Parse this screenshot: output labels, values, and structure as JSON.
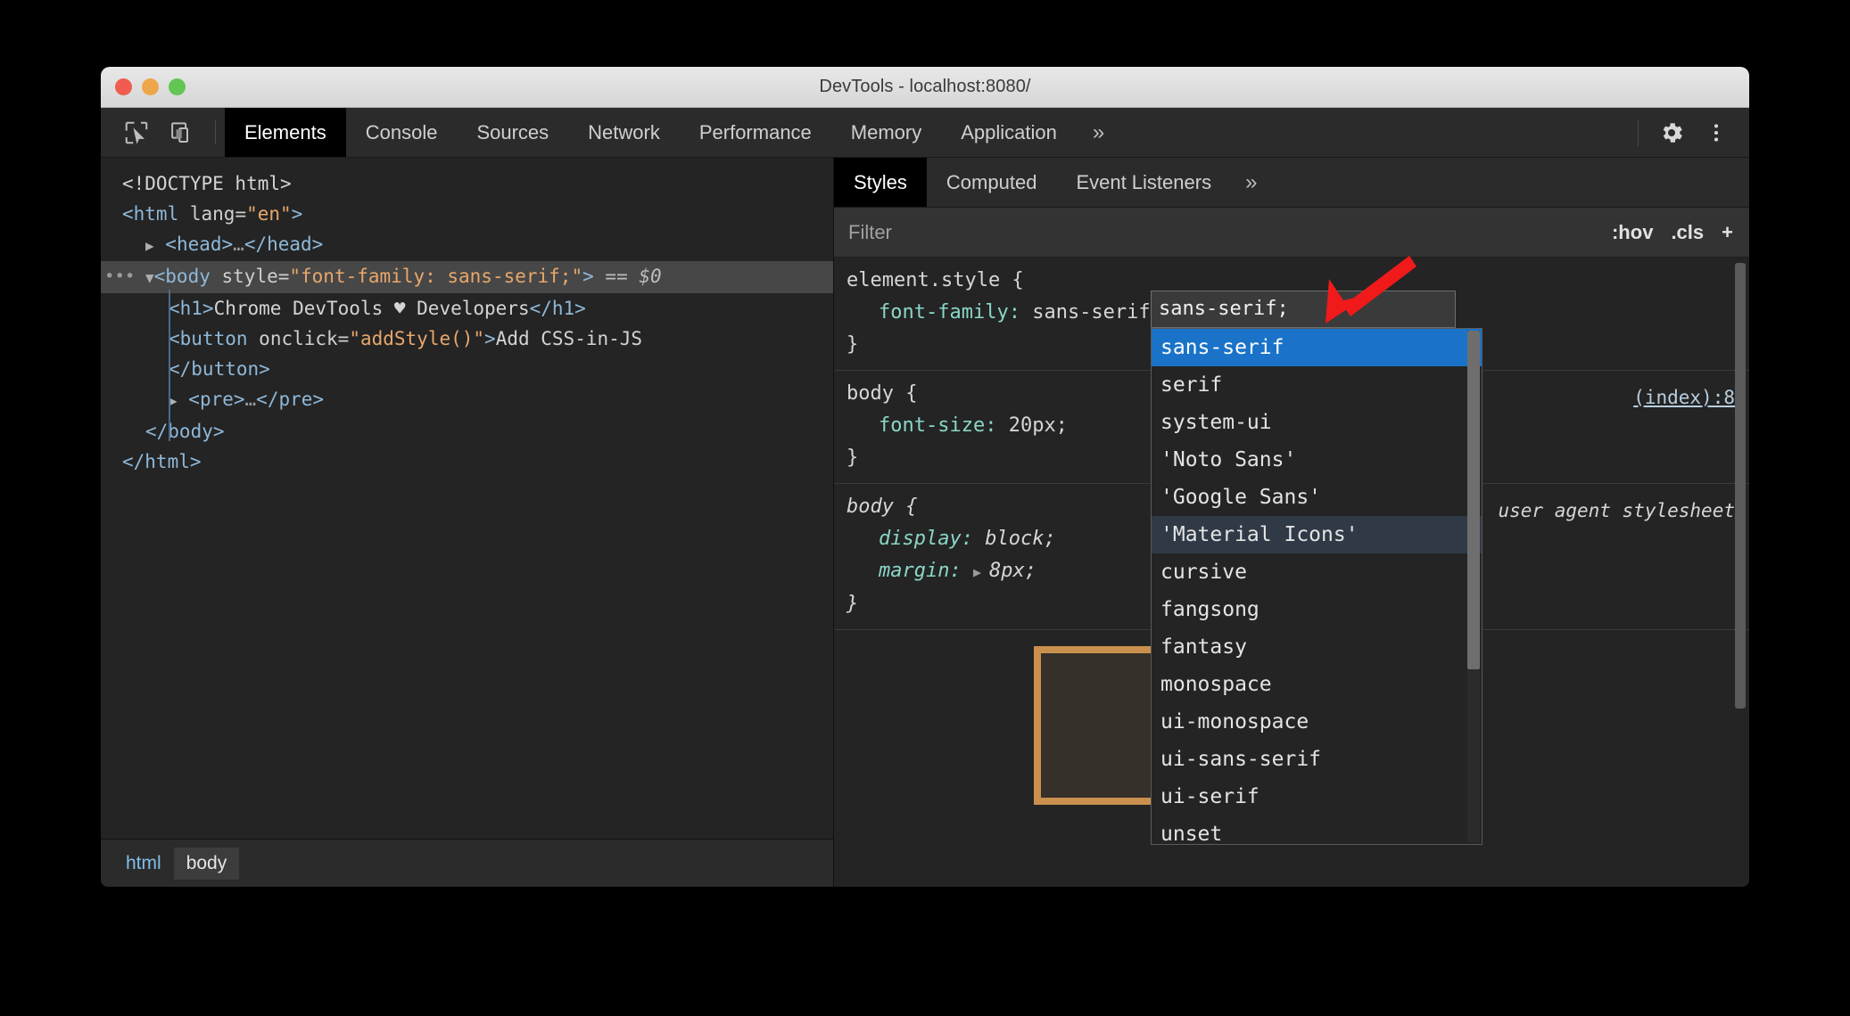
{
  "window": {
    "title": "DevTools - localhost:8080/",
    "traffic_lights": [
      "close-button",
      "minimize-button",
      "zoom-button"
    ]
  },
  "toolbar": {
    "inspect_icon": "inspect-element-icon",
    "device_icon": "device-toolbar-icon",
    "tabs": [
      {
        "label": "Elements",
        "active": true
      },
      {
        "label": "Console",
        "active": false
      },
      {
        "label": "Sources",
        "active": false
      },
      {
        "label": "Network",
        "active": false
      },
      {
        "label": "Performance",
        "active": false
      },
      {
        "label": "Memory",
        "active": false
      },
      {
        "label": "Application",
        "active": false
      }
    ],
    "more_tabs": "»",
    "settings_icon": "gear-icon",
    "menu_icon": "kebab-menu-icon"
  },
  "dom_tree": {
    "lines": [
      {
        "indent": 0,
        "html": "<span class=\"txt\">&lt;!DOCTYPE html&gt;</span>"
      },
      {
        "indent": 0,
        "html": "<span class=\"tw\">&lt;html</span> <span class=\"attr\">lang=</span><span class=\"attrval\">\"en\"</span><span class=\"tw\">&gt;</span>"
      },
      {
        "indent": 1,
        "html": "<span class=\"arrow-t\">▶</span> <span class=\"tw\">&lt;head&gt;</span><span class=\"dim\">…</span><span class=\"tw\">&lt;/head&gt;</span>"
      },
      {
        "indent": 1,
        "html": "<span class=\"arrow-t\">▼</span><span class=\"tw\">&lt;body</span> <span class=\"attr\">style=</span><span class=\"attrval\">\"font-family: sans-serif;\"</span><span class=\"tw\">&gt;</span> <span class=\"eqd\">== $0</span>",
        "selected": true
      },
      {
        "indent": 2,
        "html": "<span class=\"tw\">&lt;h1&gt;</span><span class=\"txt\">Chrome DevTools ♥ Developers</span><span class=\"tw\">&lt;/h1&gt;</span>"
      },
      {
        "indent": 2,
        "html": "<span class=\"tw\">&lt;button</span> <span class=\"attr\">onclick=</span><span class=\"attrval\">\"addStyle()\"</span><span class=\"tw\">&gt;</span><span class=\"txt\">Add CSS-in-JS</span>"
      },
      {
        "indent": 2,
        "html": "<span class=\"tw\">&lt;/button&gt;</span>"
      },
      {
        "indent": 2,
        "html": "<span class=\"arrow-t\">▶</span> <span class=\"tw\">&lt;pre&gt;</span><span class=\"dim\">…</span><span class=\"tw\">&lt;/pre&gt;</span>"
      },
      {
        "indent": 1,
        "html": "<span class=\"tw\">&lt;/body&gt;</span>"
      },
      {
        "indent": 0,
        "html": "<span class=\"tw\">&lt;/html&gt;</span>"
      }
    ],
    "selected_line_text": "<body style=\"font-family: sans-serif;\"> == $0",
    "gutter_dots": "•••"
  },
  "breadcrumb": {
    "items": [
      {
        "label": "html",
        "active": false
      },
      {
        "label": "body",
        "active": true
      }
    ]
  },
  "styles": {
    "tabs": [
      {
        "label": "Styles",
        "active": true
      },
      {
        "label": "Computed",
        "active": false
      },
      {
        "label": "Event Listeners",
        "active": false
      }
    ],
    "more_tabs": "»",
    "filter": {
      "placeholder": "Filter",
      "value": ""
    },
    "actions": {
      "hov": ":hov",
      "cls": ".cls",
      "new_rule": "+"
    },
    "rules": [
      {
        "selector": "element.style {",
        "close": "}",
        "origin": "",
        "declarations": [
          {
            "property": "font-family:",
            "value": "sans-serif;"
          }
        ]
      },
      {
        "selector": "body {",
        "close": "}",
        "origin": "(index):8",
        "declarations": [
          {
            "property": "font-size:",
            "value": "20px;"
          }
        ]
      },
      {
        "selector": "body {",
        "close": "}",
        "origin": "user agent stylesheet",
        "italic": true,
        "declarations": [
          {
            "property": "display:",
            "value": "block;"
          },
          {
            "property": "margin:",
            "value": "8px;",
            "expandable": true
          }
        ]
      }
    ]
  },
  "edit_field": {
    "value": "sans-serif;"
  },
  "autocomplete": {
    "items": [
      {
        "label": "sans-serif",
        "prefix": "s",
        "state": "selected"
      },
      {
        "label": "serif",
        "prefix": "s",
        "state": "normal"
      },
      {
        "label": "system-ui",
        "prefix": "s",
        "state": "normal"
      },
      {
        "label": "'Noto Sans'",
        "prefix": "S",
        "state": "normal"
      },
      {
        "label": "'Google Sans'",
        "prefix": "S",
        "state": "normal"
      },
      {
        "label": "'Material Icons'",
        "prefix": "s",
        "state": "hover"
      },
      {
        "label": "cursive",
        "prefix": "s",
        "state": "normal"
      },
      {
        "label": "fangsong",
        "prefix": "s",
        "state": "normal"
      },
      {
        "label": "fantasy",
        "prefix": "",
        "state": "normal"
      },
      {
        "label": "monospace",
        "prefix": "s",
        "state": "normal"
      },
      {
        "label": "ui-monospace",
        "prefix": "s",
        "state": "normal"
      },
      {
        "label": "ui-sans-serif",
        "prefix": "s",
        "state": "normal"
      },
      {
        "label": "ui-serif",
        "prefix": "s",
        "state": "normal"
      },
      {
        "label": "unset",
        "prefix": "s",
        "state": "normal"
      }
    ]
  },
  "annotations": {
    "arrow_color": "#f01a1a",
    "highlight_color": "#c9904e"
  }
}
